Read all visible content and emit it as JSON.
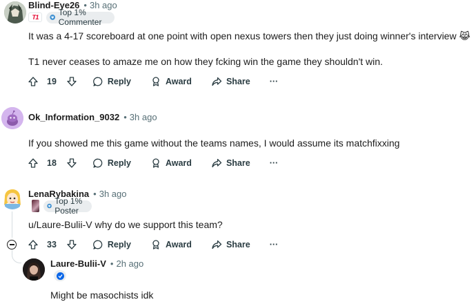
{
  "comments": [
    {
      "author": "Blind-Eye26",
      "time": "3h ago",
      "flair_text": "T1",
      "badge": "Top 1% Commenter",
      "lines": [
        "It was a 4-17 scoreboard at one point with open nexus towers then they just doing winner's interview 😹",
        "T1 never ceases to amaze me on how they fcking win the game they shouldn't win."
      ],
      "votes": "19",
      "reply": "Reply",
      "award": "Award",
      "share": "Share",
      "more": "···"
    },
    {
      "author": "Ok_Information_9032",
      "time": "3h ago",
      "lines": [
        "If you showed me this game without the teams names, I would assume its matchfixxing"
      ],
      "votes": "18",
      "reply": "Reply",
      "award": "Award",
      "share": "Share",
      "more": "···"
    },
    {
      "author": "LenaRybakina",
      "time": "3h ago",
      "badge": "Top 1% Poster",
      "lines": [
        "u/Laure-Bulii-V why do we support this team?"
      ],
      "votes": "33",
      "reply": "Reply",
      "award": "Award",
      "share": "Share",
      "more": "···"
    },
    {
      "author": "Laure-Bulii-V",
      "time": "2h ago",
      "lines": [
        "Might be masochists idk"
      ]
    }
  ],
  "colors": {
    "text": "#1c1c1c",
    "meta": "#576f76",
    "badge_bg": "#eaedef",
    "thread_line": "#d6dde0",
    "t1_red": "#e4002b",
    "verified_blue": "#0a66e8"
  }
}
